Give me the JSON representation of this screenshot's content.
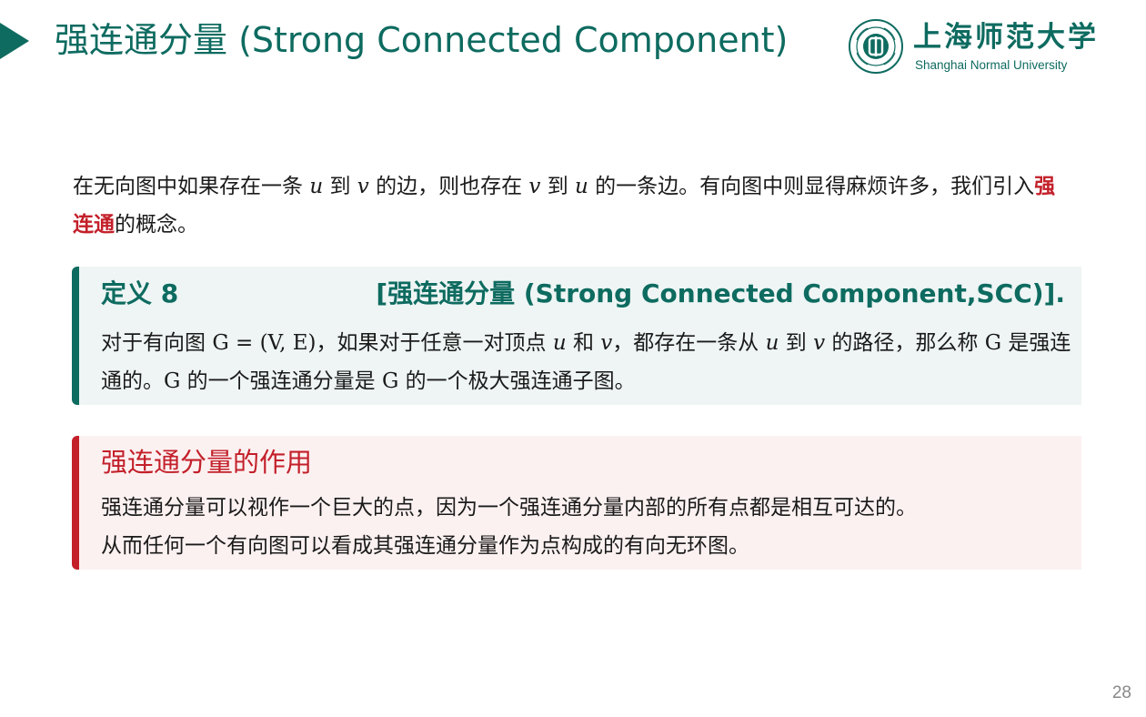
{
  "header": {
    "title": "强连通分量 (Strong Connected Component)"
  },
  "logo": {
    "cn": "上海师范大学",
    "en": "Shanghai Normal University"
  },
  "intro": {
    "p1": "在无向图中如果存在一条 ",
    "u1": "u",
    "p2": " 到 ",
    "v1": "v",
    "p3": " 的边，则也存在 ",
    "v2": "v",
    "p4": " 到 ",
    "u2": "u",
    "p5": " 的一条边。有向图中则显得麻烦许多，我们引入",
    "highlight": "强连通",
    "p6": "的概念。"
  },
  "definition": {
    "label": "定义 8",
    "name": "[强连通分量 (Strong Connected Component,SCC)].",
    "b1": "对于有向图 ",
    "m1": "G = (V, E)",
    "b2": "，如果对于任意一对顶点 ",
    "m2": "u",
    "b3": " 和 ",
    "m3": "v",
    "b4": "，都存在一条从 ",
    "m4": "u",
    "b5": " 到 ",
    "m5": "v",
    "b6": " 的路径，那么称 ",
    "m6": "G",
    "b7": " 是强连通的。",
    "m7": "G",
    "b8": " 的一个强连通分量是 ",
    "m8": "G",
    "b9": " 的一个极大强连通子图。"
  },
  "note": {
    "title": "强连通分量的作用",
    "line1": "强连通分量可以视作一个巨大的点，因为一个强连通分量内部的所有点都是相互可达的。",
    "line2": "从而任何一个有向图可以看成其强连通分量作为点构成的有向无环图。"
  },
  "footer": {
    "page_number": "28"
  },
  "colors": {
    "brand": "#0e6b60",
    "accent": "#c3202a",
    "def_bg": "#eef5f4",
    "note_bg": "#fcf1f1"
  }
}
